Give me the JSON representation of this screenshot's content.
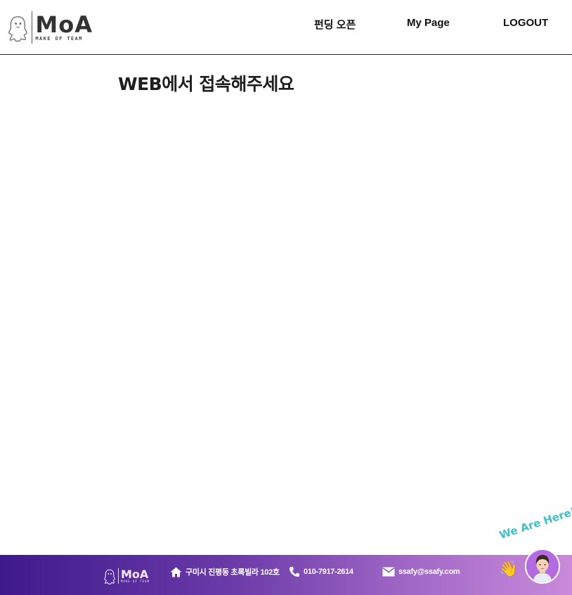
{
  "header": {
    "logo": {
      "wordmark": "MoA",
      "tagline": "MAKE  OF TEAM"
    },
    "nav": {
      "funding_open": "펀딩 오픈",
      "my_page": "My Page",
      "logout": "LOGOUT"
    }
  },
  "main": {
    "headline": "WEB에서 접속해주세요"
  },
  "footer": {
    "logo": {
      "wordmark": "MoA",
      "tagline": "MAKE OF TEAM"
    },
    "address": "구미시 진평동 초록빌라 102호",
    "phone": "010-7917-2614",
    "email": "ssafy@ssafy.com"
  },
  "chat_widget": {
    "label": "We Are Here!"
  },
  "colors": {
    "footer_gradient_start": "#3f1a8c",
    "footer_gradient_end": "#c98adb",
    "chat_label": "#3fbfc9",
    "avatar_bg": "#b46ae0"
  },
  "icons": {
    "home": "home-icon",
    "phone": "phone-icon",
    "email": "mail-icon",
    "wave": "waving-hand-icon",
    "ghost": "ghost-logo-icon"
  }
}
